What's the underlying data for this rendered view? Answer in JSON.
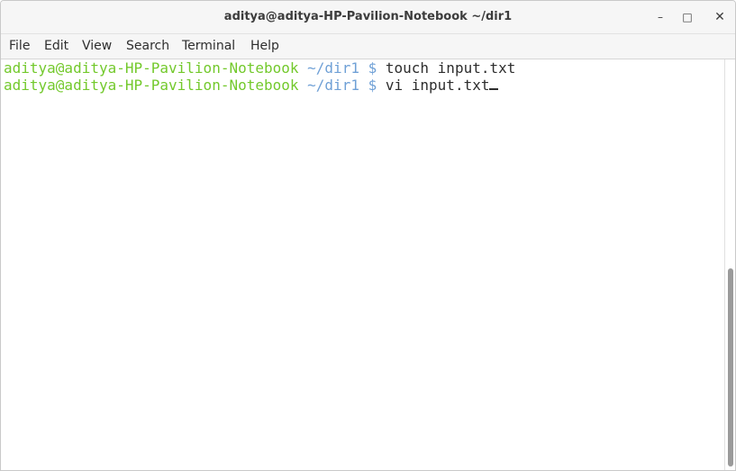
{
  "window": {
    "title": "aditya@aditya-HP-Pavilion-Notebook ~/dir1",
    "minimize_glyph": "–",
    "maximize_glyph": "□",
    "close_glyph": "✕"
  },
  "menu": {
    "items": [
      "File",
      "Edit",
      "View",
      "Search",
      "Terminal",
      "Help"
    ]
  },
  "terminal": {
    "lines": [
      {
        "user": "aditya@aditya-HP-Pavilion-Notebook",
        "path": "~/dir1",
        "symbol": "$",
        "command": "touch input.txt"
      },
      {
        "user": "aditya@aditya-HP-Pavilion-Notebook",
        "path": "~/dir1",
        "symbol": "$",
        "command": "vi input.txt"
      }
    ]
  },
  "colors": {
    "prompt_user": "#73c92c",
    "prompt_path": "#6fa0d6",
    "text": "#2e2e2e",
    "background": "#ffffff"
  }
}
